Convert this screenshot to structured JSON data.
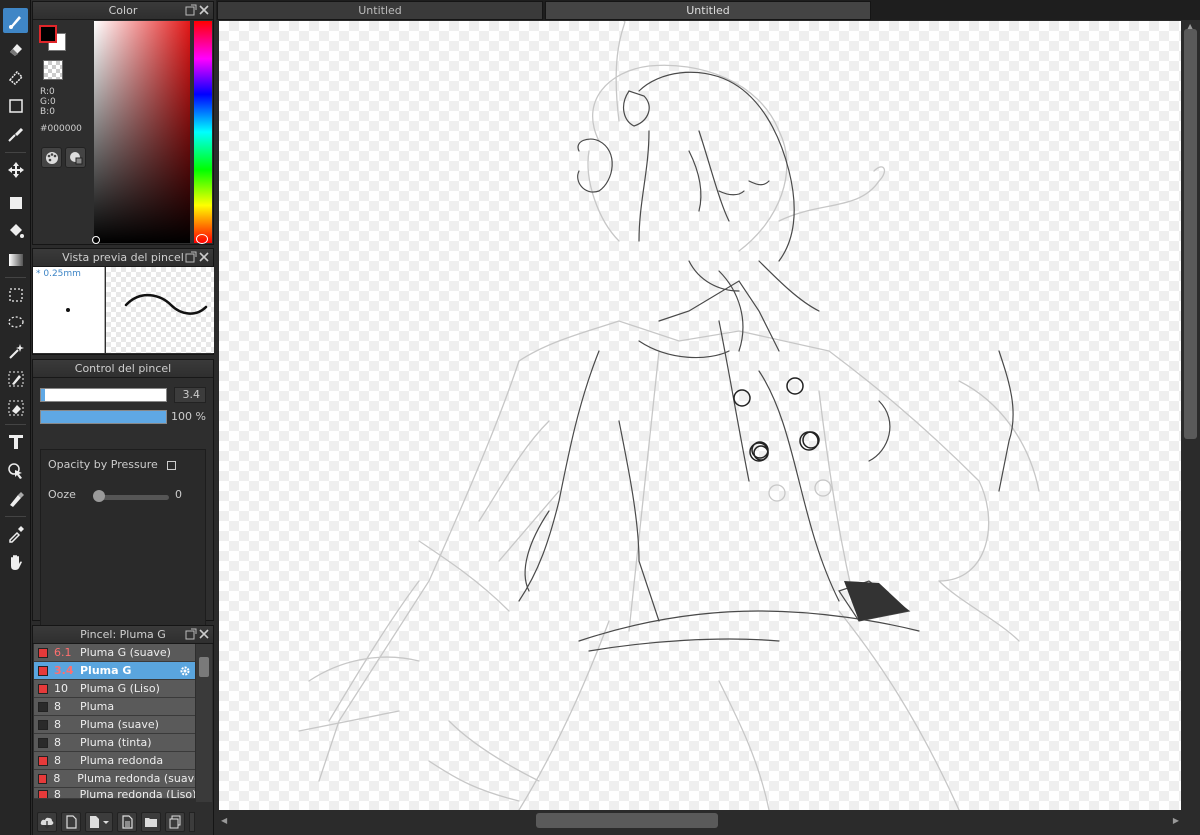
{
  "tabs": [
    {
      "label": "Untitled",
      "active": false
    },
    {
      "label": "Untitled",
      "active": true
    }
  ],
  "color_panel": {
    "title": "Color",
    "r": "R:0",
    "g": "G:0",
    "b": "B:0",
    "hex": "#000000",
    "foreground": "#000000",
    "background": "#ffffff"
  },
  "brush_preview": {
    "title": "Vista previa del pincel",
    "size": "* 0.25mm"
  },
  "brush_control": {
    "title": "Control del pincel",
    "size_value": "3.4",
    "opacity_value": "100 %",
    "opacity_pressure_label": "Opacity by Pressure",
    "ooze_label": "Ooze",
    "ooze_value": "0"
  },
  "brush_list": {
    "title": "Pincel: Pluma G",
    "items": [
      {
        "color": "#e63a3a",
        "size": "6.1",
        "name": "Pluma G (suave)",
        "red": true
      },
      {
        "color": "#e63a3a",
        "size": "3.4",
        "name": "Pluma G",
        "red": true,
        "selected": true
      },
      {
        "color": "#e63a3a",
        "size": "10",
        "name": "Pluma G (Liso)"
      },
      {
        "color": "#2a2a2a",
        "size": "8",
        "name": "Pluma"
      },
      {
        "color": "#2a2a2a",
        "size": "8",
        "name": "Pluma (suave)"
      },
      {
        "color": "#2a2a2a",
        "size": "8",
        "name": "Pluma (tinta)"
      },
      {
        "color": "#e63a3a",
        "size": "8",
        "name": "Pluma redonda"
      },
      {
        "color": "#e63a3a",
        "size": "8",
        "name": "Pluma redonda (suave)"
      },
      {
        "color": "#e63a3a",
        "size": "8",
        "name": "Pluma redonda (Liso)"
      }
    ]
  },
  "tools": [
    "brush-icon",
    "eraser-icon",
    "blur-eraser-icon",
    "rectangle-icon",
    "line-brush-icon",
    "move-icon",
    "fill-rect-icon",
    "bucket-icon",
    "gradient-icon",
    "rect-select-icon",
    "lasso-icon",
    "magic-wand-icon",
    "select-pen-icon",
    "select-eraser-icon",
    "text-icon",
    "select-pointer-icon",
    "divide-icon",
    "eyedropper-icon",
    "hand-icon"
  ],
  "accent": "#3f86c6"
}
